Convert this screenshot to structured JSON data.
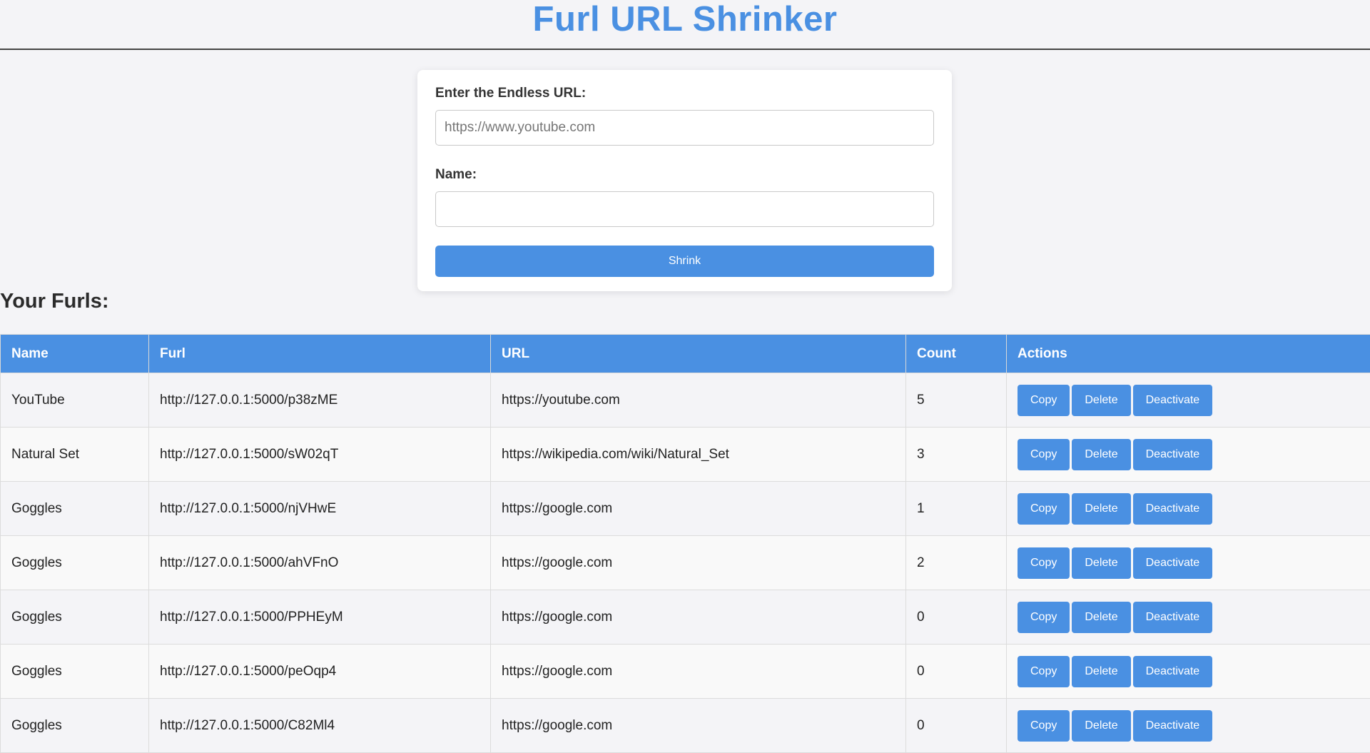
{
  "header": {
    "title": "Furl URL Shrinker"
  },
  "form": {
    "url_label": "Enter the Endless URL:",
    "url_placeholder": "https://www.youtube.com",
    "url_value": "",
    "name_label": "Name:",
    "name_placeholder": "",
    "name_value": "",
    "submit_label": "Shrink"
  },
  "list": {
    "heading": "Your Furls:",
    "columns": [
      "Name",
      "Furl",
      "URL",
      "Count",
      "Actions"
    ],
    "rows": [
      {
        "name": "YouTube",
        "furl": "http://127.0.0.1:5000/p38zME",
        "url": "https://youtube.com",
        "count": "5"
      },
      {
        "name": "Natural Set",
        "furl": "http://127.0.0.1:5000/sW02qT",
        "url": "https://wikipedia.com/wiki/Natural_Set",
        "count": "3"
      },
      {
        "name": "Goggles",
        "furl": "http://127.0.0.1:5000/njVHwE",
        "url": "https://google.com",
        "count": "1"
      },
      {
        "name": "Goggles",
        "furl": "http://127.0.0.1:5000/ahVFnO",
        "url": "https://google.com",
        "count": "2"
      },
      {
        "name": "Goggles",
        "furl": "http://127.0.0.1:5000/PPHEyM",
        "url": "https://google.com",
        "count": "0"
      },
      {
        "name": "Goggles",
        "furl": "http://127.0.0.1:5000/peOqp4",
        "url": "https://google.com",
        "count": "0"
      },
      {
        "name": "Goggles",
        "furl": "http://127.0.0.1:5000/C82Ml4",
        "url": "https://google.com",
        "count": "0"
      }
    ],
    "actions": {
      "copy": "Copy",
      "delete": "Delete",
      "deactivate": "Deactivate"
    }
  },
  "colors": {
    "accent": "#4a90e2",
    "background": "#f4f4f7"
  }
}
